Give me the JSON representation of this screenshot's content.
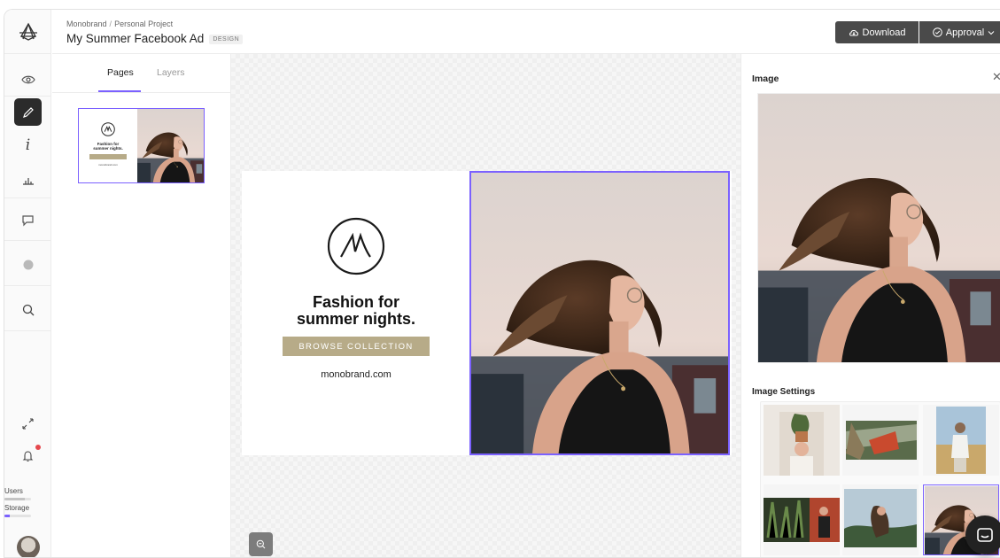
{
  "header": {
    "breadcrumb": [
      "Monobrand",
      "Personal Project"
    ],
    "title": "My Summer Facebook Ad",
    "badge": "DESIGN",
    "download_label": "Download",
    "approval_label": "Approval"
  },
  "rail": {
    "icons": [
      "eye-icon",
      "pen-icon",
      "info-icon",
      "chart-icon",
      "comment-icon",
      "circle-icon",
      "search-icon",
      "expand-icon",
      "bell-icon"
    ],
    "users_label": "Users",
    "users_usage": 0.75,
    "storage_label": "Storage",
    "storage_usage": 0.2
  },
  "pages_panel": {
    "tabs": [
      "Pages",
      "Layers"
    ],
    "active_tab": "Pages",
    "thumbnail": {
      "headline": "Fashion for summer nights.",
      "url": "monobrand.com"
    }
  },
  "ad": {
    "headline": "Fashion for\nsummer nights.",
    "cta": "BROWSE COLLECTION",
    "url": "monobrand.com"
  },
  "right_panel": {
    "title": "Image",
    "settings_title": "Image Settings",
    "selected_image_index": 5
  },
  "colors": {
    "accent": "#7b61ff",
    "cta": "#b7ab88",
    "dark_button": "#4a4a4a"
  }
}
